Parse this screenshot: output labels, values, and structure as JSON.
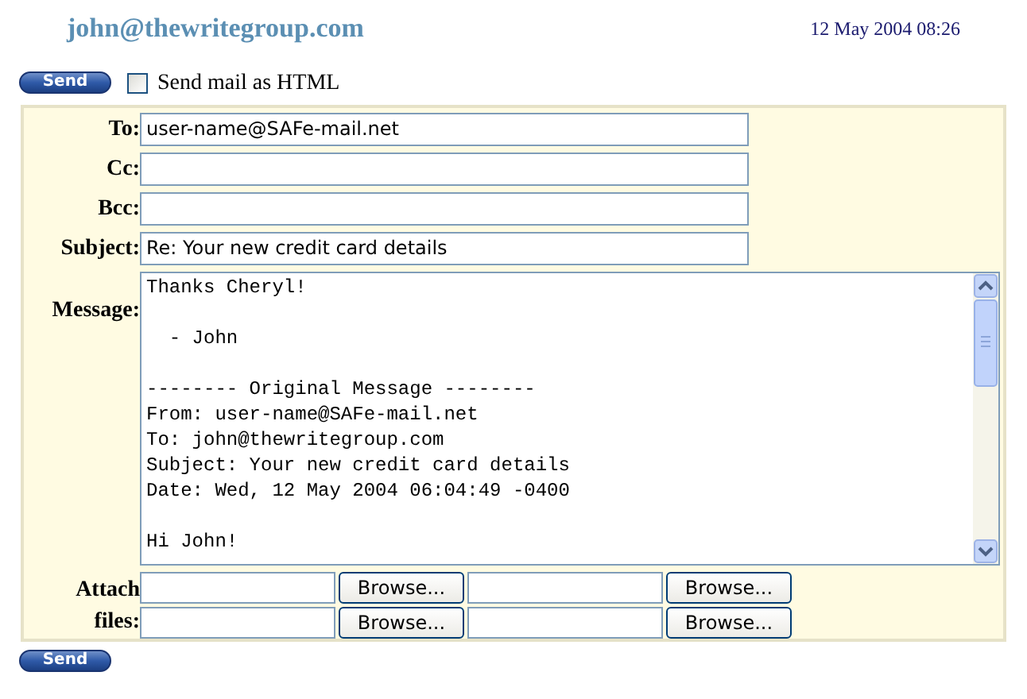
{
  "header": {
    "account": "john@thewritegroup.com",
    "datetime": "12 May 2004 08:26"
  },
  "top_send_button": "Send",
  "html_option": {
    "label": "Send mail as HTML",
    "checked": false
  },
  "fields": [
    {
      "label": "To:",
      "value": "user-name@SAFe-mail.net"
    },
    {
      "label": "Cc:"
    },
    {
      "label": "Bcc:"
    },
    {
      "label": "Subject:",
      "value": "Re: Your new credit card details"
    }
  ],
  "message": {
    "label": "Message:",
    "value": "Thanks Cheryl!\n\n  - John\n\n-------- Original Message --------\nFrom: user-name@SAFe-mail.net\nTo: john@thewritegroup.com\nSubject: Your new credit card details\nDate: Wed, 12 May 2004 06:04:49 -0400\n\nHi John!"
  },
  "attachments": {
    "label": "Attach files:",
    "browse_buttons": [
      "Browse...",
      "Browse...",
      "Browse...",
      "Browse..."
    ]
  },
  "bottom_send_button": "Send"
}
